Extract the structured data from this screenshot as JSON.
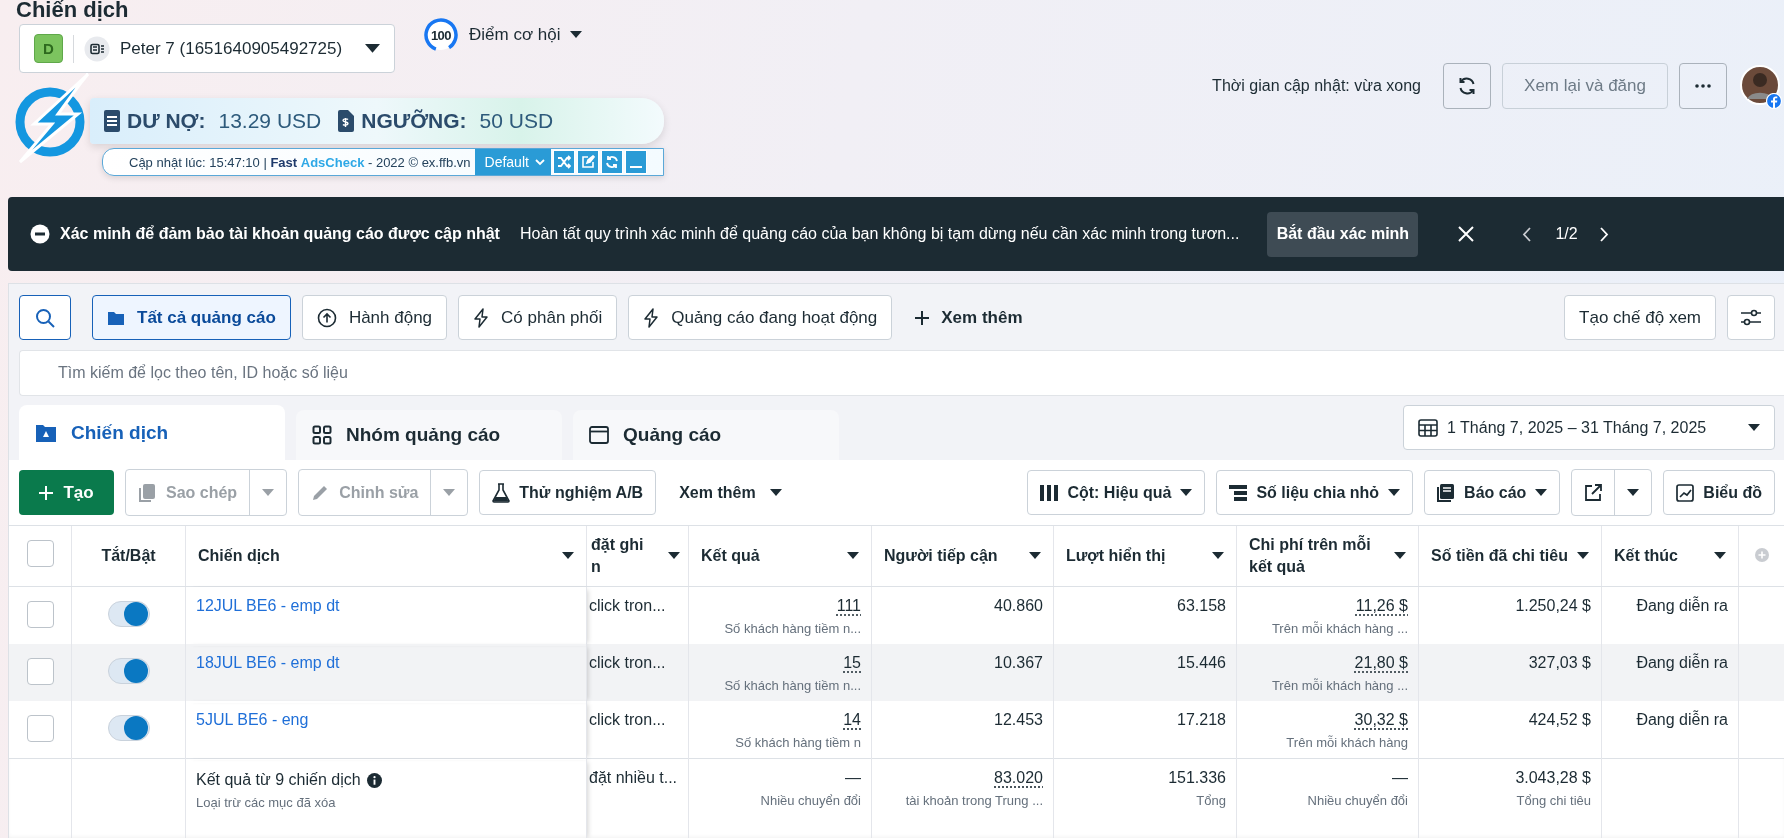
{
  "page_title": "Chiến dịch",
  "account": {
    "badge": "D",
    "name": "Peter 7 (1651640905492725)"
  },
  "opportunity": {
    "score": "100",
    "label": "Điểm cơ hội"
  },
  "update_status": "Thời gian cập nhật: vừa xong",
  "review_button": {
    "label": "Xem lại và đăng",
    "disabled": true
  },
  "extension": {
    "debt_label": "DƯ NỢ:",
    "debt_value": "13.29 USD",
    "threshold_label": "NGƯỠNG:",
    "threshold_value": "50 USD",
    "updated": "Cập nhật lúc: 15:47:10 |",
    "brand_bold": "Fast",
    "brand_accent": "AdsCheck",
    "suffix": "- 2022 © ex.ffb.vn",
    "preset": "Default"
  },
  "banner": {
    "title": "Xác minh để đảm bảo tài khoản quảng cáo được cập nhật",
    "message": "Hoàn tất quy trình xác minh để quảng cáo của bạn không bị tạm dừng nếu cần xác minh trong tươn...",
    "action": "Bắt đầu xác minh",
    "pager": "1/2"
  },
  "filters": [
    {
      "label": "Tất cả quảng cáo",
      "kind": "folder",
      "selected": true
    },
    {
      "label": "Hành động",
      "kind": "action",
      "selected": false
    },
    {
      "label": "Có phân phối",
      "kind": "delivery",
      "selected": false
    },
    {
      "label": "Quảng cáo đang hoạt động",
      "kind": "delivery",
      "selected": false
    }
  ],
  "more_filters": "Xem thêm",
  "create_view": "Tạo chế độ xem",
  "search": {
    "placeholder": "Tìm kiếm để lọc theo tên, ID hoặc số liệu"
  },
  "level_tabs": [
    {
      "label": "Chiến dịch",
      "kind": "campaign",
      "selected": true
    },
    {
      "label": "Nhóm quảng cáo",
      "kind": "adset",
      "selected": false
    },
    {
      "label": "Quảng cáo",
      "kind": "ad",
      "selected": false
    }
  ],
  "date_range": "1 Tháng 7, 2025 – 31 Tháng 7, 2025",
  "toolbar": {
    "create": "Tạo",
    "duplicate": {
      "label": "Sao chép",
      "disabled": true
    },
    "edit": {
      "label": "Chỉnh sửa",
      "disabled": true
    },
    "ab_test": "Thử nghiệm A/B",
    "more": "Xem thêm",
    "columns": "Cột: Hiệu quả",
    "breakdown": "Số liệu chia nhỏ",
    "reports": "Báo cáo",
    "chart": "Biểu đồ"
  },
  "table": {
    "select_all": {
      "checked": false
    },
    "columns": [
      "Tắt/Bật",
      "Chiến dịch",
      "đặt ghi\nn",
      "Kết quả",
      "Người tiếp cận",
      "Lượt hiển thị",
      "Chi phí trên mỗi kết quả",
      "Số tiền đã chi tiêu",
      "Kết thúc"
    ],
    "rows": [
      {
        "selected": false,
        "on": true,
        "hovered": false,
        "name": "12JUL BE6 - emp dt",
        "column_3": "click tron...",
        "result": "111",
        "result_sub": "Số khách hàng tiềm n...",
        "reach": "40.860",
        "impressions": "63.158",
        "cost": "11,26 $",
        "cost_sub": "Trên mỗi khách hàng ...",
        "spent": "1.250,24 $",
        "end": "Đang diễn ra"
      },
      {
        "selected": false,
        "on": true,
        "hovered": true,
        "name": "18JUL BE6 - emp dt",
        "column_3": "click tron...",
        "result": "15",
        "result_sub": "Số khách hàng tiềm n...",
        "reach": "10.367",
        "impressions": "15.446",
        "cost": "21,80 $",
        "cost_sub": "Trên mỗi khách hàng ...",
        "spent": "327,03 $",
        "end": "Đang diễn ra"
      },
      {
        "selected": false,
        "on": true,
        "hovered": false,
        "name": "5JUL BE6 - eng",
        "column_3": "click tron...",
        "result": "14",
        "result_sub": "Số khách hàng tiềm n",
        "reach": "12.453",
        "impressions": "17.218",
        "cost": "30,32 $",
        "cost_sub": "Trên mỗi khách hàng",
        "spent": "424,52 $",
        "end": "Đang diễn ra"
      }
    ],
    "summary": {
      "title": "Kết quả từ 9 chiến dịch",
      "sub": "Loại trừ các mục đã xóa",
      "column_3": "đặt nhiều t...",
      "result": "—",
      "result_sub": "Nhiều chuyển đổi",
      "reach": "83.020",
      "reach_sub": "tài khoản trong Trung ...",
      "impressions": "151.336",
      "impressions_sub": "Tổng",
      "cost": "—",
      "cost_sub": "Nhiều chuyển đổi",
      "spent": "3.043,28 $",
      "spent_sub": "Tổng chi tiêu"
    }
  }
}
